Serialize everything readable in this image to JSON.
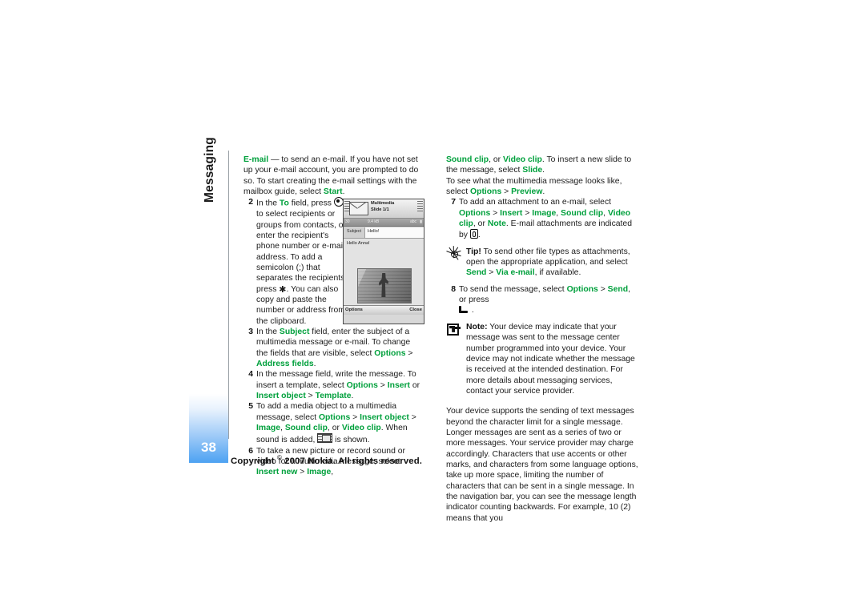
{
  "document": {
    "chapter": "Messaging",
    "page_number": "38",
    "footer": "Copyright © 2007 Nokia. All rights reserved.",
    "footer_prefix": "Copyright",
    "footer_symbol": "©",
    "footer_suffix": "2007 Nokia. All rights reserved."
  },
  "colors": {
    "accent_green": "#00a03c",
    "page_tab_blue": "#4da2f2",
    "body_text": "#1b1b1b"
  },
  "left_column": {
    "email_paragraph": {
      "term": "E-mail",
      "dash": " — ",
      "text_1": "to send an e-mail. If you have not set up your e-mail account, you are prompted to do so. To start creating the e-mail settings with the mailbox guide, select ",
      "term_2": "Start",
      "text_2": "."
    },
    "step2": {
      "num": "2",
      "text_a": "In the ",
      "field": "To",
      "text_b": " field, press ",
      "icon": "scroll-key-icon",
      "text_c": " to select recipients or groups from contacts, or enter the recipient's phone number or e-mail address. To add a semicolon (;) that separates the recipients, press ",
      "star": "✱",
      "text_d": ". You can also copy and paste the number or address from the clipboard."
    },
    "step3": {
      "num": "3",
      "text_a": "In the ",
      "field": "Subject",
      "text_b": " field, enter the subject of a multimedia message or e-mail. To change the fields that are visible, select ",
      "opt1": "Options",
      "gt1": " > ",
      "opt2": "Address fields",
      "text_c": "."
    },
    "step4": {
      "num": "4",
      "text_a": "In the message field, write the message. To insert a template, select ",
      "opt1": "Options",
      "gt1": " > ",
      "opt2": "Insert",
      "text_b": " or ",
      "opt3": "Insert object",
      "gt2": " > ",
      "opt4": "Template",
      "text_c": "."
    },
    "step5": {
      "num": "5",
      "text_a": "To add a media object to a multimedia message, select ",
      "opt1": "Options",
      "gt1": " > ",
      "opt2": "Insert object",
      "gt2": " > ",
      "opt3": "Image",
      "comma1": ", ",
      "opt4": "Sound clip",
      "text_b": ", or ",
      "opt5": "Video clip",
      "text_c": ". When sound is added, ",
      "icon": "sound-clip-icon",
      "text_d": " is shown."
    },
    "step6": {
      "num": "6",
      "text_a": "To take a new picture or record sound or video for a multimedia message, select ",
      "opt1": "Insert new",
      "gt1": " > ",
      "opt2": "Image",
      "text_b": ","
    }
  },
  "right_column": {
    "step6_cont": {
      "opt1": "Sound clip",
      "text_a": ", or ",
      "opt2": "Video clip",
      "text_b": ". To insert a new slide to the message, select ",
      "opt3": "Slide",
      "text_c": "."
    },
    "preview_line": {
      "text_a": "To see what the multimedia message looks like, select ",
      "opt1": "Options",
      "gt1": " > ",
      "opt2": "Preview",
      "text_b": "."
    },
    "step7": {
      "num": "7",
      "text_a": "To add an attachment to an e-mail, select ",
      "opt1": "Options",
      "gt1": " > ",
      "opt2": "Insert",
      "gt2": " > ",
      "opt3": "Image",
      "comma1": ", ",
      "opt4": "Sound clip",
      "comma2": ", ",
      "opt5": "Video clip",
      "text_b": ", or ",
      "opt6": "Note",
      "text_c": ". E-mail attachments are indicated by ",
      "icon": "attachment-clip-icon",
      "text_d": "."
    },
    "tip": {
      "icon": "tip-bulb-icon",
      "label": "Tip!",
      "text_a": " To send other file types as attachments, open the appropriate application, and select ",
      "opt1": "Send",
      "gt1": " > ",
      "opt2": "Via e-mail",
      "text_b": ", if available."
    },
    "step8": {
      "num": "8",
      "text_a": "To send the message, select ",
      "opt1": "Options",
      "gt1": " > ",
      "opt2": "Send",
      "text_b": ", or press ",
      "icon": "call-key-icon",
      "text_c": " ."
    },
    "note": {
      "icon": "note-icon",
      "label": "Note:",
      "text": " Your device may indicate that your message was sent to the message center number programmed into your device. Your device may not indicate whether the message is received at the intended destination. For more details about messaging services, contact your service provider."
    },
    "closing_paragraph": "Your device supports the sending of text messages beyond the character limit for a single message. Longer messages are sent as a series of two or more messages. Your service provider may charge accordingly. Characters that use accents or other marks, and characters from some language options, take up more space, limiting the number of characters that can be sent in a single message. In the navigation bar, you can see the message length indicator counting backwards. For example, 10 (2) means that you"
  },
  "phone_screenshot": {
    "header_line1": "Multimedia",
    "header_line2": "Slide 1/1",
    "status_left": "30",
    "status_size": "9.4 kB",
    "status_mode": "abc",
    "subject_label": "Subject",
    "subject_value": "Hello!",
    "message_body": "Hello Anna!",
    "softkey_left": "Options",
    "softkey_right": "Close",
    "envelope_icon": "envelope-icon",
    "image_placeholder": "brick-wall-photo"
  }
}
